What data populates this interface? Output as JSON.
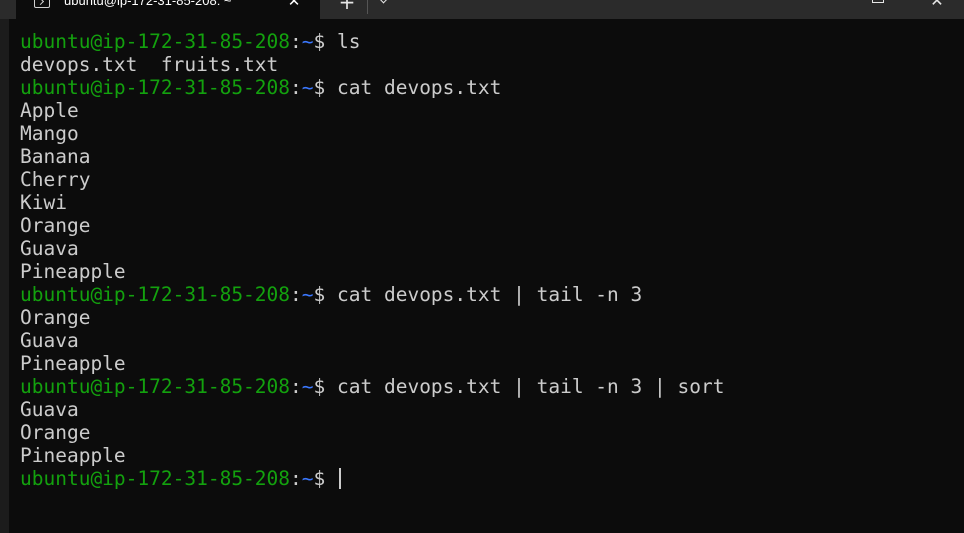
{
  "window": {
    "tab_title": "ubuntu@ip-172-31-85-208: ~",
    "close_tab_glyph": "✕",
    "new_tab_glyph": "+",
    "close_window_glyph": "✕"
  },
  "prompt": {
    "user_host": "ubuntu@ip-172-31-85-208",
    "separator": ":",
    "path": "~",
    "symbol": "$ "
  },
  "session": [
    {
      "type": "cmd",
      "text": "ls"
    },
    {
      "type": "out",
      "text": "devops.txt  fruits.txt"
    },
    {
      "type": "cmd",
      "text": "cat devops.txt"
    },
    {
      "type": "out",
      "text": "Apple"
    },
    {
      "type": "out",
      "text": "Mango"
    },
    {
      "type": "out",
      "text": "Banana"
    },
    {
      "type": "out",
      "text": "Cherry"
    },
    {
      "type": "out",
      "text": "Kiwi"
    },
    {
      "type": "out",
      "text": "Orange"
    },
    {
      "type": "out",
      "text": "Guava"
    },
    {
      "type": "out",
      "text": "Pineapple"
    },
    {
      "type": "cmd",
      "text": "cat devops.txt | tail -n 3"
    },
    {
      "type": "out",
      "text": "Orange"
    },
    {
      "type": "out",
      "text": "Guava"
    },
    {
      "type": "out",
      "text": "Pineapple"
    },
    {
      "type": "cmd",
      "text": "cat devops.txt | tail -n 3 | sort"
    },
    {
      "type": "out",
      "text": "Guava"
    },
    {
      "type": "out",
      "text": "Orange"
    },
    {
      "type": "out",
      "text": "Pineapple"
    },
    {
      "type": "cmd",
      "text": "",
      "active": true
    }
  ],
  "colors": {
    "background": "#0c0c0c",
    "user_host": "#13a10e",
    "path": "#3b78ff",
    "text": "#cccccc"
  },
  "icons": {
    "tab": "terminal-icon",
    "tab_close": "close-icon",
    "new_tab": "plus-icon",
    "dropdown": "chevron-down-icon",
    "maximize": "maximize-icon",
    "close_window": "close-icon"
  }
}
